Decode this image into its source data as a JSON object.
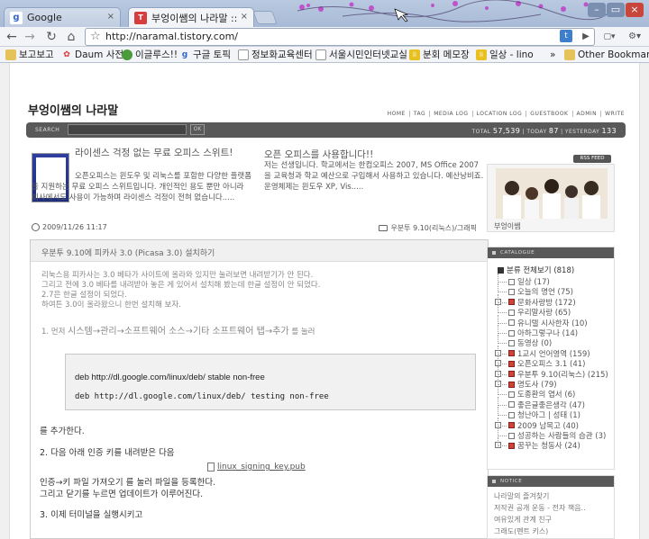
{
  "browser": {
    "tabs": [
      {
        "label": "Google",
        "favicon": "google-favicon",
        "active": false
      },
      {
        "label": "부엉이쌤의 나라말 ::",
        "favicon": "tistory-favicon",
        "active": true
      }
    ],
    "close_glyph": "×",
    "window_controls": {
      "minimize": "–",
      "maximize": "▭",
      "close": "×"
    },
    "nav": {
      "back": "←",
      "forward": "→",
      "reload": "↻",
      "home": "⌂",
      "star": "☆"
    },
    "url": "http://naramal.tistory.com/",
    "toolbar_right": {
      "page_menu": "▢▾",
      "wrench_menu": "⚙▾",
      "extension": "t",
      "play": "▶"
    },
    "bookmarks": [
      {
        "label": "보고보고",
        "icon": "folder-icon"
      },
      {
        "label": "Daum 사전",
        "icon": "daum-icon"
      },
      {
        "label": "이글루스!!",
        "icon": "egloos-icon"
      },
      {
        "label": "구글 토픽",
        "icon": "google-icon"
      },
      {
        "label": "정보화교육센터",
        "icon": "page-icon"
      },
      {
        "label": "서울시민인터넷교실",
        "icon": "page-icon"
      },
      {
        "label": "분회 메모장",
        "icon": "springnote-icon"
      },
      {
        "label": "일상 - lino",
        "icon": "springnote-icon"
      }
    ],
    "bookmarks_more": "»",
    "other_bookmarks": "Other Bookmarks"
  },
  "blog": {
    "title": "부엉이쌤의 나라말",
    "nav": [
      "HOME",
      "TAG",
      "MEDIA LOG",
      "LOCATION LOG",
      "GUESTBOOK",
      "ADMIN",
      "WRITE"
    ],
    "search_label": "SEARCH",
    "search_button": "OK",
    "counter": {
      "total_label": "TOTAL",
      "total": "57,539",
      "today_label": "TODAY",
      "today": "87",
      "yesterday_label": "YESTERDAY",
      "yesterday": "133"
    }
  },
  "ads": {
    "ad1_title": "라이센스 걱정 없는 무료 오피스 스위트!",
    "ad1_body": "오픈오피스는 윈도우 및 리눅스를 포함한 다양한 플랫폼을 지원하는 무료 오피스 스위트입니다. 개인적인 용도 뿐만 아니라 회사에서도 사용이 가능하며 라이센스 걱정이 전혀 없습니다.....",
    "ad2_title": "오픈 오피스를 사용합니다!!",
    "ad2_body": "저는 선생입니다. 학교에서는 한컴오피스 2007, MS Office 2007을 교육청과 학교 예산으로 구입해서 사용하고 있습니다. 예산낭비죠. 운영체제는 윈도우 XP, Vis....."
  },
  "post": {
    "date": "2009/11/26 11:17",
    "category": "우분투 9.10(리눅스)/그래픽",
    "title": "우분투 9.10에 피카사 3.0 (Picasa 3.0) 설치하기",
    "intro": [
      "리눅스용 피카사는 3.0 베타가 사이트에 올라와 있지만 눌러보면 내려받기가 안 된다.",
      "그리고 전에 3.0 베타를 내려받아 놓은 게 있어서 설치해 봤는데 한글 설정이 안 되었다.",
      "2.7은 한글 설정이 되었다.",
      "하여튼 3.0이 올라왔으니 한번 설치해 보자."
    ],
    "step1_prefix": "1. 먼저",
    "step1_path": "시스템→관리→소프트웨어 소스→기타 소프트웨어 탭→추가",
    "step1_suffix": "를 눌러",
    "code_line1": "deb http://dl.google.com/linux/deb/ stable non-free",
    "code_line2": "deb http://dl.google.com/linux/deb/ testing non-free",
    "after_code": "를 추가한다.",
    "step2": "2. 다음 아래 인증 키를 내려받은 다음",
    "file_link": "linux_signing_key.pub",
    "step2_a": "인증→키 파일 가져오기 를 눌러 파일을 등록한다.",
    "step2_b": "그리고 닫기를 누르면 업데이트가 이루어진다.",
    "step3": "3. 이제 터미널을 실행시키고"
  },
  "sidebar": {
    "rss": "RSS FEED",
    "profile_name": "부엉이쌤",
    "catalogue_head": "CATALOGUE",
    "category_root": "분류 전체보기 (818)",
    "categories": [
      {
        "label": "일상 (17)",
        "expandable": false,
        "red": false
      },
      {
        "label": "오늘의 명언 (75)",
        "expandable": false,
        "red": false
      },
      {
        "label": "문화사랑방 (172)",
        "expandable": true,
        "red": true
      },
      {
        "label": "우리말사랑 (65)",
        "expandable": false,
        "red": false
      },
      {
        "label": "유니텔 시사한자 (10)",
        "expandable": false,
        "red": false
      },
      {
        "label": "아하그렇구나 (14)",
        "expandable": false,
        "red": false
      },
      {
        "label": "동영상 (0)",
        "expandable": false,
        "red": false
      },
      {
        "label": "1교시 언어영역 (159)",
        "expandable": true,
        "red": true
      },
      {
        "label": "오픈오피스 3.1 (41)",
        "expandable": true,
        "red": true
      },
      {
        "label": "우분투 9.10(리눅스) (215)",
        "expandable": true,
        "red": true
      },
      {
        "label": "명도사 (79)",
        "expandable": true,
        "red": true
      },
      {
        "label": "도종환의 엽서 (6)",
        "expandable": false,
        "red": false
      },
      {
        "label": "좋은글좋은생각 (47)",
        "expandable": false,
        "red": false
      },
      {
        "label": "청난아그 | 성태 (1)",
        "expandable": false,
        "red": false
      },
      {
        "label": "2009 남목고 (40)",
        "expandable": true,
        "red": true
      },
      {
        "label": "성공하는 사람들의 습관 (3)",
        "expandable": false,
        "red": false
      },
      {
        "label": "꿈꾸는 청동사 (24)",
        "expandable": true,
        "red": true
      }
    ],
    "notice_head": "NOTICE",
    "notices": [
      "나라말의 즐겨찾기",
      "저작권 공개 운동 - 전자 책음..",
      "여유있게 관계 친구",
      "그래도(펜트 키스)"
    ]
  }
}
